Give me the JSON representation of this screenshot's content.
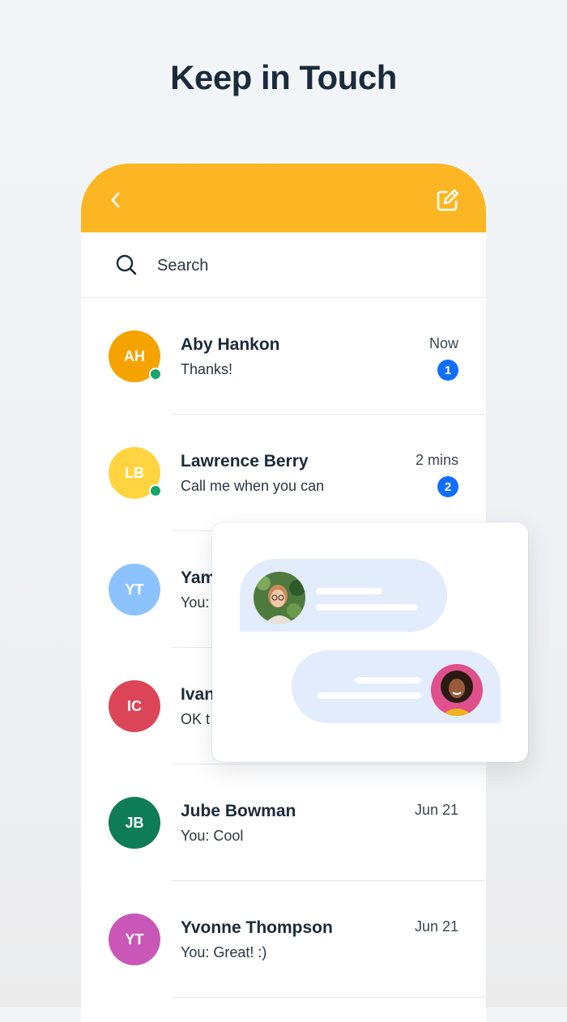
{
  "hero": {
    "title": "Keep in Touch"
  },
  "search": {
    "placeholder": "Search"
  },
  "colors": {
    "header": "#fdb623",
    "badge": "#116dff",
    "online": "#16a66b",
    "bubble": "#e2ecfc"
  },
  "icons": {
    "back": "chevron-left-icon",
    "compose": "compose-icon",
    "search": "search-icon"
  },
  "conversations": [
    {
      "initials": "AH",
      "name": "Aby Hankon",
      "preview": "Thanks!",
      "time": "Now",
      "unread": "1",
      "online": true,
      "color": "#f5a300"
    },
    {
      "initials": "LB",
      "name": "Lawrence Berry",
      "preview": "Call me when you can",
      "time": "2 mins",
      "unread": "2",
      "online": true,
      "color": "#ffd440"
    },
    {
      "initials": "YT",
      "name": "Yam",
      "preview": "You:",
      "time": "",
      "unread": "",
      "online": false,
      "color": "#8cc3ff"
    },
    {
      "initials": "IC",
      "name": "Ivan",
      "preview": "OK t",
      "time": "",
      "unread": "",
      "online": false,
      "color": "#dc4557"
    },
    {
      "initials": "JB",
      "name": "Jube Bowman",
      "preview": "You: Cool",
      "time": "Jun 21",
      "unread": "",
      "online": false,
      "color": "#0e7d57"
    },
    {
      "initials": "YT",
      "name": "Yvonne Thompson",
      "preview": "You: Great! :)",
      "time": "Jun 21",
      "unread": "",
      "online": false,
      "color": "#c957b8"
    }
  ]
}
